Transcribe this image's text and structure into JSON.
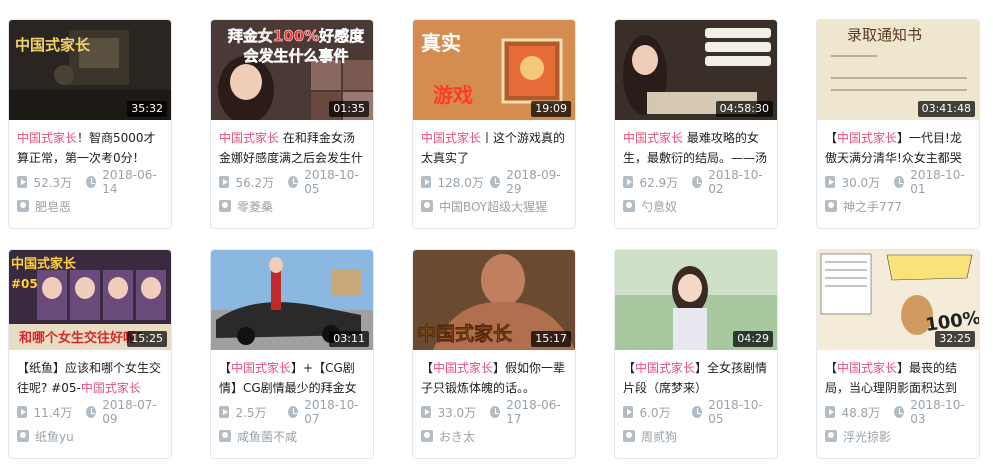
{
  "videos": [
    {
      "thumb_text": "中国式家长",
      "duration": "35:32",
      "title_hl": "中国式家长",
      "title_rest": "！智商5000才算正常，第一次考0分！",
      "views": "52.3万",
      "date": "2018-06-14",
      "uploader": "肥皂恶"
    },
    {
      "thumb_text": "拜金女100%好感度会发生什么事件",
      "duration": "01:35",
      "title_hl": "中国式家长",
      "title_rest": " 在和拜金女汤金娜好感度满之后会发生什么",
      "views": "56.2万",
      "date": "2018-10-05",
      "uploader": "零菱桑"
    },
    {
      "thumb_text": "真实游戏",
      "duration": "19:09",
      "title_hl": "中国式家长",
      "title_rest": "丨这个游戏真的太真实了",
      "views": "128.0万",
      "date": "2018-09-29",
      "uploader": "中国BOY超级大猩猩"
    },
    {
      "thumb_text": "",
      "duration": "04:58:30",
      "title_hl": "中国式家长",
      "title_rest": " 最难攻略的女生，最敷衍的结局。——汤",
      "views": "62.9万",
      "date": "2018-10-02",
      "uploader": "勺意奴"
    },
    {
      "thumb_text": "录取通知书",
      "duration": "03:41:48",
      "title_hl": "中国式家长",
      "title_pre": "【",
      "title_rest": "】一代目!龙傲天满分清华!众女主都哭",
      "views": "30.0万",
      "date": "2018-10-01",
      "uploader": "神之手777"
    },
    {
      "thumb_text": "中国式家长 #05 和哪个女生交往好呢?",
      "duration": "15:25",
      "title_pre": "【纸鱼】应该和哪个女生交往呢? #05-",
      "title_hl": "中国式家长",
      "title_rest": "",
      "views": "11.4万",
      "date": "2018-07-09",
      "uploader": "纸鱼yu"
    },
    {
      "thumb_text": "",
      "duration": "03:11",
      "title_pre": "【",
      "title_hl": "中国式家长",
      "title_rest": "】+【CG剧情】CG剧情最少的拜金女",
      "views": "2.5万",
      "date": "2018-10-07",
      "uploader": "咸鱼菌不咸"
    },
    {
      "thumb_text": "中国式家长",
      "duration": "15:17",
      "title_pre": "【",
      "title_hl": "中国式家长",
      "title_rest": "】假如你一辈子只锻炼体魄的话。。",
      "views": "33.0万",
      "date": "2018-06-17",
      "uploader": "おき太"
    },
    {
      "thumb_text": "",
      "duration": "04:29",
      "title_pre": "【",
      "title_hl": "中国式家长",
      "title_rest": "】全女孩剧情片段（席梦来）",
      "views": "6.0万",
      "date": "2018-10-05",
      "uploader": "周贰狗"
    },
    {
      "thumb_text": "100%!",
      "duration": "32:25",
      "title_pre": "【",
      "title_hl": "中国式家长",
      "title_rest": "】最丧的结局，当心理阴影面积达到",
      "views": "48.8万",
      "date": "2018-10-03",
      "uploader": "浮光掠影"
    }
  ],
  "colors": {
    "highlight": "#e8507a",
    "meta": "#99a2aa",
    "border": "#e5e9ef"
  }
}
